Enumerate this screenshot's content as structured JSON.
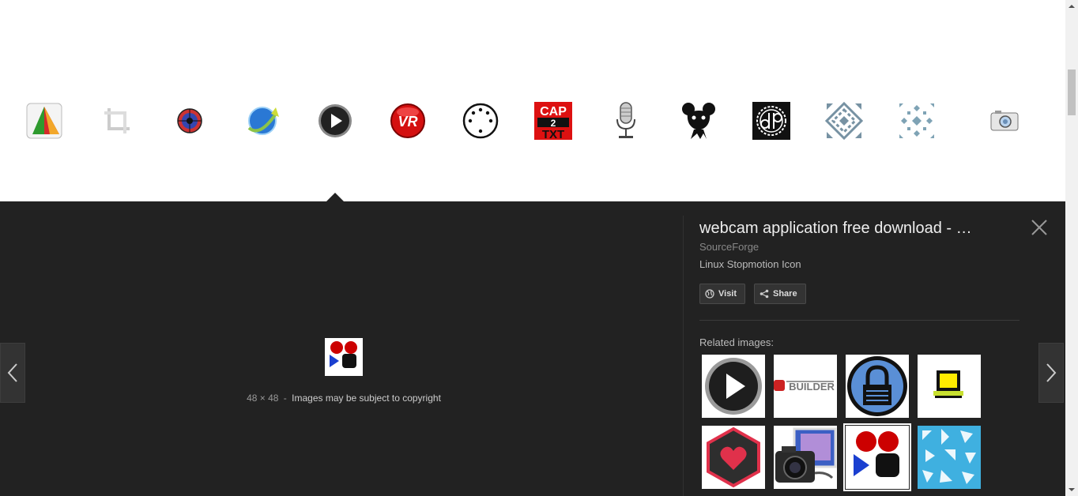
{
  "thumbnails": [
    {
      "icon": "pie-slice-icon"
    },
    {
      "icon": "crop-icon"
    },
    {
      "icon": "target-icon"
    },
    {
      "icon": "globe-sync-icon"
    },
    {
      "icon": "play-button-icon"
    },
    {
      "icon": "vr-icon"
    },
    {
      "icon": "din-connector-icon"
    },
    {
      "icon": "cap2txt-icon"
    },
    {
      "icon": "microphone-icon"
    },
    {
      "icon": "mouse-creature-icon"
    },
    {
      "icon": "db-gear-icon"
    },
    {
      "icon": "pattern-tile-icon"
    },
    {
      "icon": "pattern-cross-icon"
    },
    {
      "icon": "camera-icon"
    }
  ],
  "cap2txt": {
    "line1": "CAP",
    "line2": "2",
    "line3": "TXT"
  },
  "vr_text": "VR",
  "preview": {
    "dimensions": "48 × 48",
    "separator": "-",
    "copyright": "Images may be subject to copyright"
  },
  "details": {
    "title": "webcam application free download - …",
    "source": "SourceForge",
    "description": "Linux Stopmotion Icon",
    "visit_label": "Visit",
    "share_label": "Share",
    "related_label": "Related images:"
  },
  "related": [
    {
      "icon": "play-button-icon"
    },
    {
      "icon": "builder-logo-icon",
      "text": "BUILDER"
    },
    {
      "icon": "keepass-lock-icon"
    },
    {
      "icon": "computer-monitor-icon"
    },
    {
      "icon": "heart-hexagon-icon"
    },
    {
      "icon": "camera-photo-icon"
    },
    {
      "icon": "stopmotion-icon"
    },
    {
      "icon": "pattern-tile-icon"
    }
  ],
  "colors": {
    "panel_bg": "#222222",
    "accent_red": "#cc0000",
    "accent_blue": "#1a3fd0"
  }
}
